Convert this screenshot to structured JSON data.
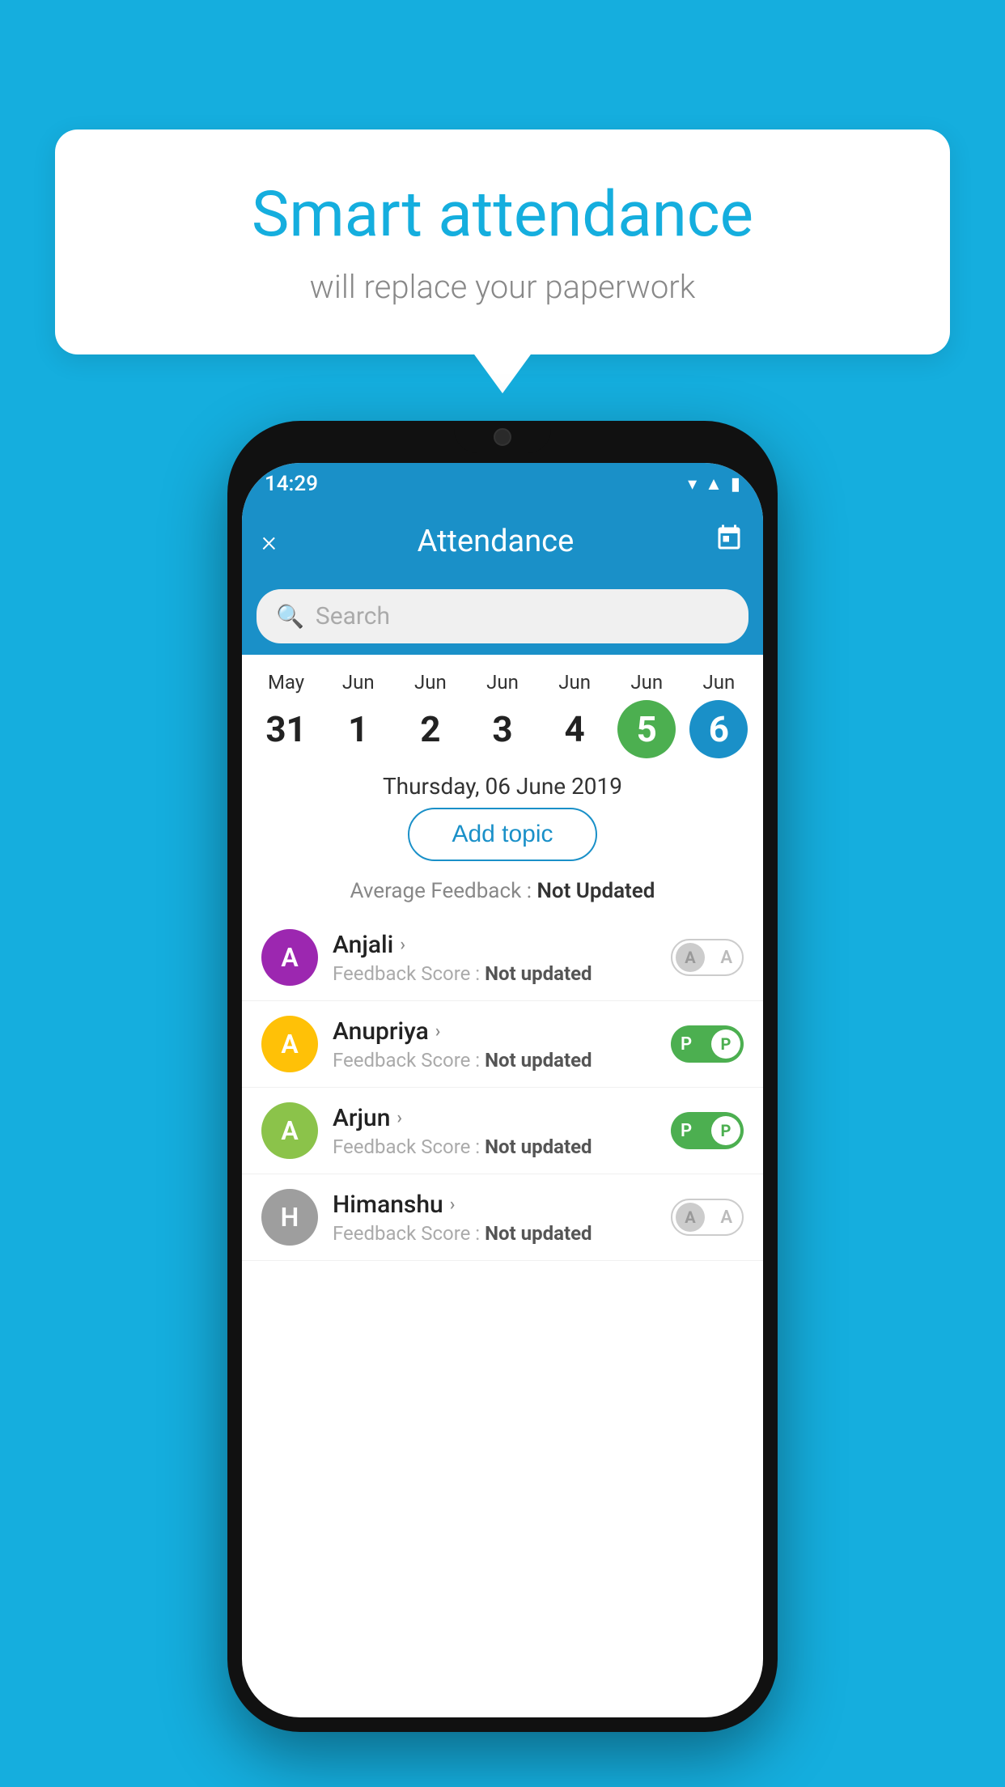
{
  "background_color": "#15AEDE",
  "bubble": {
    "title": "Smart attendance",
    "subtitle": "will replace your paperwork"
  },
  "phone": {
    "status_bar": {
      "time": "14:29",
      "icons": [
        "wifi",
        "signal",
        "battery"
      ]
    },
    "header": {
      "title": "Attendance",
      "close_label": "×",
      "calendar_icon": "📅"
    },
    "search": {
      "placeholder": "Search"
    },
    "dates": [
      {
        "month": "May",
        "day": "31",
        "selected": false
      },
      {
        "month": "Jun",
        "day": "1",
        "selected": false
      },
      {
        "month": "Jun",
        "day": "2",
        "selected": false
      },
      {
        "month": "Jun",
        "day": "3",
        "selected": false
      },
      {
        "month": "Jun",
        "day": "4",
        "selected": false
      },
      {
        "month": "Jun",
        "day": "5",
        "selected": "green"
      },
      {
        "month": "Jun",
        "day": "6",
        "selected": "blue"
      }
    ],
    "selected_date_label": "Thursday, 06 June 2019",
    "add_topic_label": "Add topic",
    "avg_feedback_label": "Average Feedback :",
    "avg_feedback_value": "Not Updated",
    "students": [
      {
        "name": "Anjali",
        "avatar_letter": "A",
        "avatar_color": "#9C27B0",
        "feedback_label": "Feedback Score :",
        "feedback_value": "Not updated",
        "toggle_state": "off",
        "toggle_letter": "A"
      },
      {
        "name": "Anupriya",
        "avatar_letter": "A",
        "avatar_color": "#FFC107",
        "feedback_label": "Feedback Score :",
        "feedback_value": "Not updated",
        "toggle_state": "on",
        "toggle_letter": "P"
      },
      {
        "name": "Arjun",
        "avatar_letter": "A",
        "avatar_color": "#8BC34A",
        "feedback_label": "Feedback Score :",
        "feedback_value": "Not updated",
        "toggle_state": "on",
        "toggle_letter": "P"
      },
      {
        "name": "Himanshu",
        "avatar_letter": "H",
        "avatar_color": "#9E9E9E",
        "feedback_label": "Feedback Score :",
        "feedback_value": "Not updated",
        "toggle_state": "off",
        "toggle_letter": "A"
      }
    ]
  }
}
